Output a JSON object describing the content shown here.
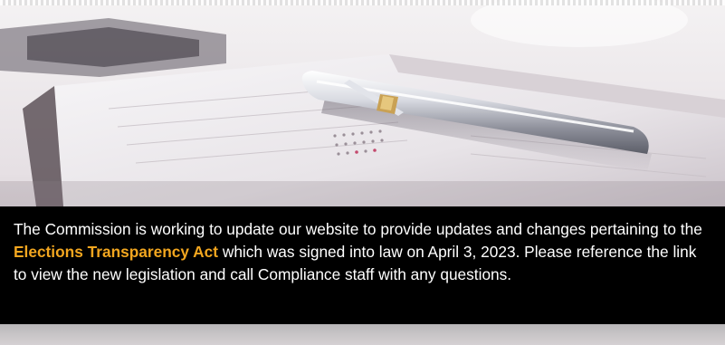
{
  "hero": {
    "image_icon": "desk-planner-pen-photo",
    "caption": {
      "text_before_link": "The Commission is working to update our website to provide updates and changes pertaining to the ",
      "link_text": "Elections Transparency Act",
      "text_after_link": " which was signed into law on April 3, 2023. Please reference the link to view the new legislation and call Compliance staff with any questions.",
      "link_color": "#f2a61f",
      "background_color": "#000000"
    }
  }
}
